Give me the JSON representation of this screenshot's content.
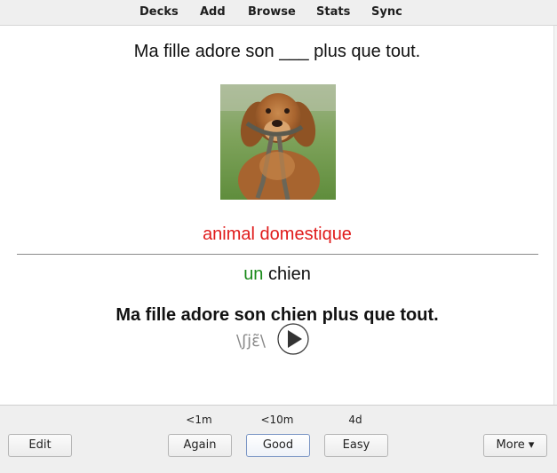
{
  "toolbar": {
    "items": [
      "Decks",
      "Add",
      "Browse",
      "Stats",
      "Sync"
    ]
  },
  "card": {
    "question": "Ma fille adore son ___ plus que tout.",
    "image_alt": "golden retriever holding leash",
    "hint": "animal domestique",
    "answer_article": "un",
    "answer_noun": "chien",
    "full_sentence": "Ma fille adore son chien plus que tout.",
    "ipa": "\\ʃjɛ̃\\",
    "hint_color": "#e01b1b",
    "article_color": "#1a8a1a"
  },
  "bottom": {
    "edit_label": "Edit",
    "more_label": "More ▾",
    "answers": [
      {
        "interval": "<1m",
        "label": "Again"
      },
      {
        "interval": "<10m",
        "label": "Good"
      },
      {
        "interval": "4d",
        "label": "Easy"
      }
    ]
  },
  "icons": {
    "play": "play-icon"
  }
}
